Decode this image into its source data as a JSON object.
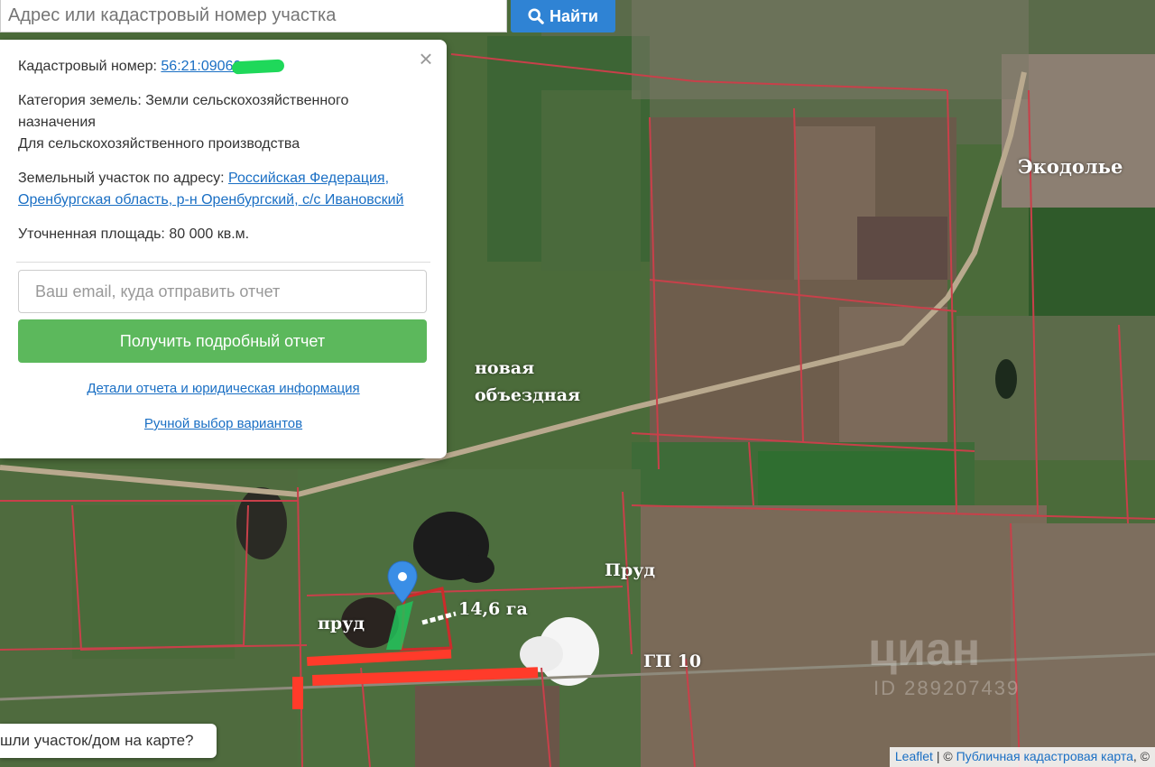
{
  "search": {
    "placeholder": "Адрес или кадастровый номер участка",
    "button_label": "Найти"
  },
  "popup": {
    "cadastral_label": "Кадастровый номер:",
    "cadastral_value": "56:21:09060",
    "category_label": "Категория земель:",
    "category_value": "Земли сельскохозяйственного назначения",
    "category_use": "Для сельскохозяйственного производства",
    "address_label": "Земельный участок по адресу:",
    "address_value": "Российская Федерация, Оренбургская область, р-н Оренбургский, с/с Ивановский",
    "area_label": "Уточненная площадь:",
    "area_value": "80 000 кв.м.",
    "email_placeholder": "Ваш email, куда отправить отчет",
    "report_button": "Получить подробный отчет",
    "details_link": "Детали отчета и юридическая информация",
    "manual_link": "Ручной выбор вариантов"
  },
  "found_prompt": "шли участок/дом на карте?",
  "attribution": {
    "leaflet": "Leaflet",
    "sep": " | © ",
    "pkk": "Публичная кадастровая карта",
    "tail": ", ©"
  },
  "map_labels": {
    "ekodolye": "Экодолье",
    "bypass_1": "новая",
    "bypass_2": "объездная",
    "pond_lower": "пруд",
    "pond_upper": "Пруд",
    "area": "14,6 га",
    "gp": "ГП 10"
  },
  "watermark": {
    "brand": "циан",
    "id": "ID 289207439"
  },
  "colors": {
    "boundary": "#c8404a",
    "highlight": "#ff3b2a",
    "search_button": "#2f83d4",
    "report_button": "#5cb85c",
    "link": "#1a6fc4",
    "marker": "#3a8ee6"
  }
}
